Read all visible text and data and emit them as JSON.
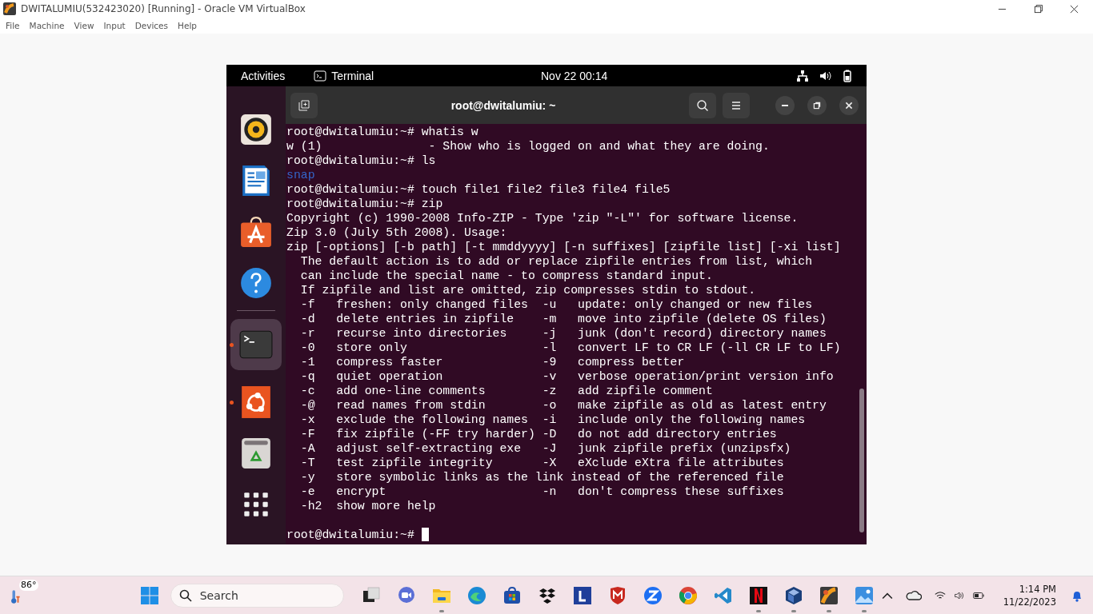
{
  "window": {
    "title": "DWITALUMIU(532423020) [Running] - Oracle VM VirtualBox"
  },
  "menu": [
    "File",
    "Machine",
    "View",
    "Input",
    "Devices",
    "Help"
  ],
  "vm": {
    "topbar": {
      "activities": "Activities",
      "app": "Terminal",
      "clock": "Nov 22  00:14"
    },
    "dock": [
      {
        "kind": "speaker",
        "running": false,
        "selected": false
      },
      {
        "kind": "document",
        "running": false,
        "selected": false
      },
      {
        "kind": "bag",
        "running": false,
        "selected": false
      },
      {
        "kind": "help",
        "running": false,
        "selected": false
      },
      {
        "kind": "terminal",
        "running": true,
        "selected": true
      },
      {
        "kind": "circle",
        "running": true,
        "selected": false
      },
      {
        "kind": "trash",
        "running": false,
        "selected": false
      },
      {
        "kind": "grid",
        "running": false,
        "selected": false
      }
    ],
    "terminal": {
      "title": "root@dwitalumiu: ~",
      "lines": [
        {
          "kind": "prompt",
          "text": "root@dwitalumiu:~# whatis w"
        },
        {
          "kind": "output",
          "text": "w (1)               - Show who is logged on and what they are doing."
        },
        {
          "kind": "prompt",
          "text": "root@dwitalumiu:~# ls"
        },
        {
          "kind": "dir",
          "text": "snap"
        },
        {
          "kind": "prompt",
          "text": "root@dwitalumiu:~# touch file1 file2 file3 file4 file5"
        },
        {
          "kind": "prompt",
          "text": "root@dwitalumiu:~# zip"
        },
        {
          "kind": "output",
          "text": "Copyright (c) 1990-2008 Info-ZIP - Type 'zip \"-L\"' for software license."
        },
        {
          "kind": "output",
          "text": "Zip 3.0 (July 5th 2008). Usage:"
        },
        {
          "kind": "output",
          "text": "zip [-options] [-b path] [-t mmddyyyy] [-n suffixes] [zipfile list] [-xi list]"
        },
        {
          "kind": "output",
          "text": "  The default action is to add or replace zipfile entries from list, which"
        },
        {
          "kind": "output",
          "text": "  can include the special name - to compress standard input."
        },
        {
          "kind": "output",
          "text": "  If zipfile and list are omitted, zip compresses stdin to stdout."
        },
        {
          "kind": "output",
          "text": "  -f   freshen: only changed files  -u   update: only changed or new files"
        },
        {
          "kind": "output",
          "text": "  -d   delete entries in zipfile    -m   move into zipfile (delete OS files)"
        },
        {
          "kind": "output",
          "text": "  -r   recurse into directories     -j   junk (don't record) directory names"
        },
        {
          "kind": "output",
          "text": "  -0   store only                   -l   convert LF to CR LF (-ll CR LF to LF)"
        },
        {
          "kind": "output",
          "text": "  -1   compress faster              -9   compress better"
        },
        {
          "kind": "output",
          "text": "  -q   quiet operation              -v   verbose operation/print version info"
        },
        {
          "kind": "output",
          "text": "  -c   add one-line comments        -z   add zipfile comment"
        },
        {
          "kind": "output",
          "text": "  -@   read names from stdin        -o   make zipfile as old as latest entry"
        },
        {
          "kind": "output",
          "text": "  -x   exclude the following names  -i   include only the following names"
        },
        {
          "kind": "output",
          "text": "  -F   fix zipfile (-FF try harder) -D   do not add directory entries"
        },
        {
          "kind": "output",
          "text": "  -A   adjust self-extracting exe   -J   junk zipfile prefix (unzipsfx)"
        },
        {
          "kind": "output",
          "text": "  -T   test zipfile integrity       -X   eXclude eXtra file attributes"
        },
        {
          "kind": "output",
          "text": "  -y   store symbolic links as the link instead of the referenced file"
        },
        {
          "kind": "output",
          "text": "  -e   encrypt                      -n   don't compress these suffixes"
        },
        {
          "kind": "output",
          "text": "  -h2  show more help"
        },
        {
          "kind": "blank"
        },
        {
          "kind": "cursor",
          "text": "root@dwitalumiu:~# "
        }
      ]
    }
  },
  "taskbar": {
    "weather": "86°",
    "search": {
      "placeholder": "Search"
    },
    "apps": [
      {
        "kind": "squares",
        "running": false
      },
      {
        "kind": "camera",
        "running": false
      },
      {
        "kind": "folder",
        "running": true
      },
      {
        "kind": "wave",
        "running": false
      },
      {
        "kind": "store",
        "running": false
      },
      {
        "kind": "boxes",
        "running": false
      },
      {
        "kind": "letter",
        "running": false
      },
      {
        "kind": "shield",
        "running": false
      },
      {
        "kind": "zed",
        "running": false
      },
      {
        "kind": "ring",
        "running": false
      },
      {
        "kind": "code",
        "running": false
      },
      {
        "kind": "film",
        "running": true
      },
      {
        "kind": "cube",
        "running": true
      },
      {
        "kind": "vbox",
        "running": true
      },
      {
        "kind": "photo",
        "running": true
      }
    ],
    "time": "1:14 PM",
    "date": "11/22/2023"
  }
}
